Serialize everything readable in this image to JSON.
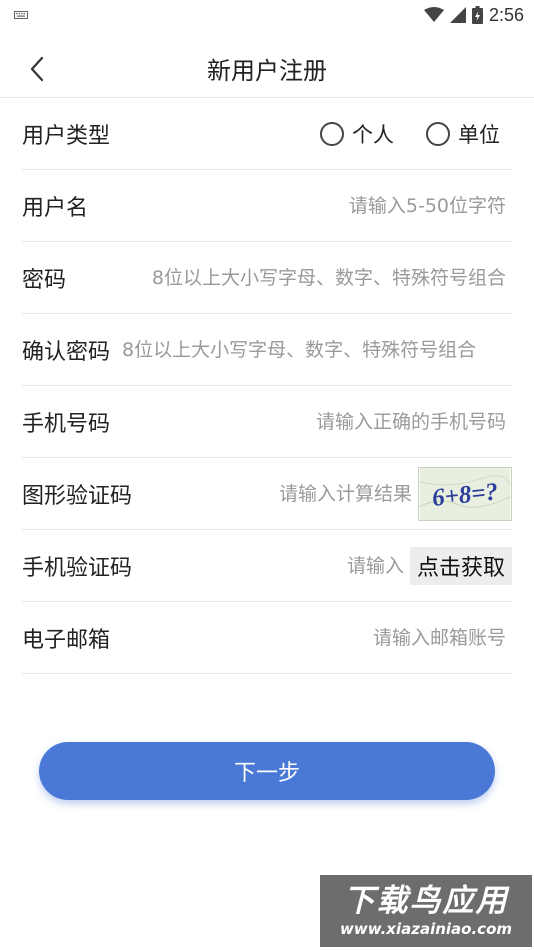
{
  "status_bar": {
    "time": "2:56",
    "icons": [
      "keyboard-icon",
      "wifi-icon",
      "signal-icon",
      "battery-icon"
    ]
  },
  "header": {
    "title": "新用户注册",
    "back_icon": "chevron-left-icon"
  },
  "form": {
    "user_type": {
      "label": "用户类型",
      "options": [
        "个人",
        "单位"
      ]
    },
    "username": {
      "label": "用户名",
      "placeholder": "请输入5-50位字符"
    },
    "password": {
      "label": "密码",
      "placeholder": "8位以上大小写字母、数字、特殊符号组合"
    },
    "confirm_password": {
      "label": "确认密码",
      "placeholder": "8位以上大小写字母、数字、特殊符号组合"
    },
    "phone": {
      "label": "手机号码",
      "placeholder": "请输入正确的手机号码"
    },
    "captcha": {
      "label": "图形验证码",
      "placeholder": "请输入计算结果",
      "image_text": "6+8=?"
    },
    "sms_code": {
      "label": "手机验证码",
      "placeholder": "请输入",
      "button": "点击获取"
    },
    "email": {
      "label": "电子邮箱",
      "placeholder": "请输入邮箱账号"
    }
  },
  "actions": {
    "next": "下一步"
  },
  "watermark": {
    "title": "下载鸟应用",
    "url": "www.xiazainiao.com"
  },
  "colors": {
    "primary": "#4a78d6",
    "divider": "#e6e6e6",
    "placeholder": "#9a9a9a"
  }
}
